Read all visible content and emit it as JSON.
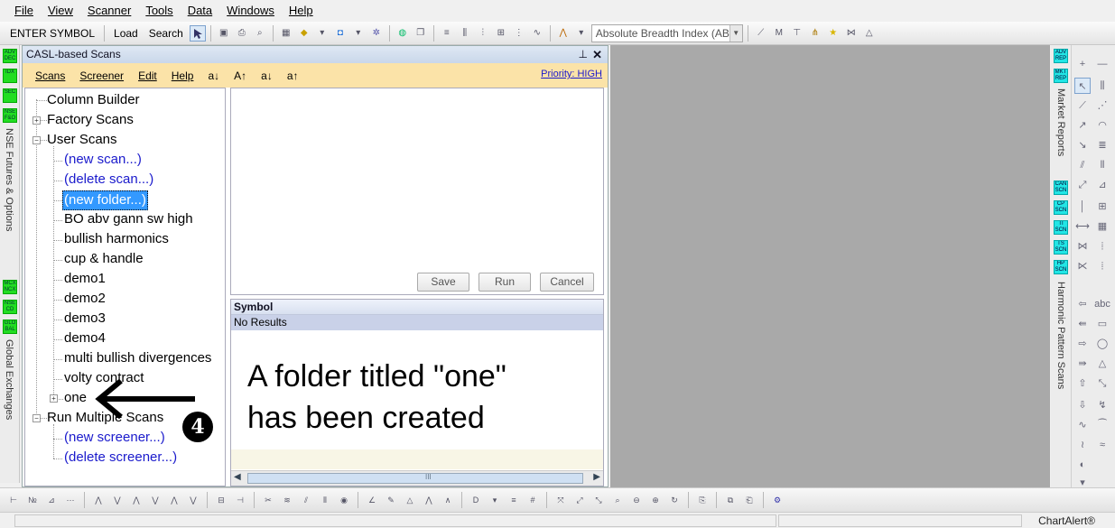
{
  "menu": [
    "File",
    "View",
    "Scanner",
    "Tools",
    "Data",
    "Windows",
    "Help"
  ],
  "toolbar": {
    "enter_symbol": "ENTER SYMBOL",
    "load": "Load",
    "search": "Search",
    "breadth_index": "Absolute Breadth Index (ABI"
  },
  "left_strip": {
    "buttons_top": [
      "ADV DEC",
      "IDX",
      "SEC",
      "NSE F&O"
    ],
    "label_top": "NSE Futures & Options",
    "buttons_bottom": [
      "MCX NCX",
      "NSE CD",
      "GLO BAL"
    ],
    "label_bottom": "Global Exchanges"
  },
  "panel": {
    "title": "CASL-based Scans",
    "pin": "⊥",
    "close": "✕",
    "submenu": [
      "Scans",
      "Screener",
      "Edit",
      "Help"
    ],
    "sort_icons": [
      "a↓",
      "A↑",
      "a↓",
      "a↑"
    ],
    "priority": "Priority: HIGH"
  },
  "tree": {
    "column_builder": "Column Builder",
    "factory_scans": "Factory Scans",
    "user_scans": "User Scans",
    "new_scan": "(new scan...)",
    "delete_scan": "(delete scan...)",
    "new_folder": "(new folder...)",
    "scans": [
      "BO abv gann sw high",
      "bullish harmonics",
      "cup & handle",
      "demo1",
      "demo2",
      "demo3",
      "demo4",
      "multi bullish divergences",
      "volty contract"
    ],
    "one": "one",
    "run_multiple": "Run Multiple Scans",
    "new_screener": "(new screener...)",
    "delete_screener": "(delete screener...)"
  },
  "editor": {
    "save": "Save",
    "run": "Run",
    "cancel": "Cancel"
  },
  "results": {
    "header": "Symbol",
    "no_results": "No Results",
    "annotation_line1": "A folder titled \"one\"",
    "annotation_line2": "has been created",
    "scroll_mark": "III",
    "step_badge": "4"
  },
  "right_strip": {
    "buttons_top": [
      "ADV REP",
      "MKT REP"
    ],
    "label_top": "Market Reports",
    "buttons_bottom": [
      "CAN SCN",
      "CP SCN",
      "TI SCN",
      "TS SCN",
      "HP SCN"
    ],
    "label_bottom": "Harmonic Pattern Scans"
  },
  "status": {
    "brand": "ChartAlert®"
  }
}
